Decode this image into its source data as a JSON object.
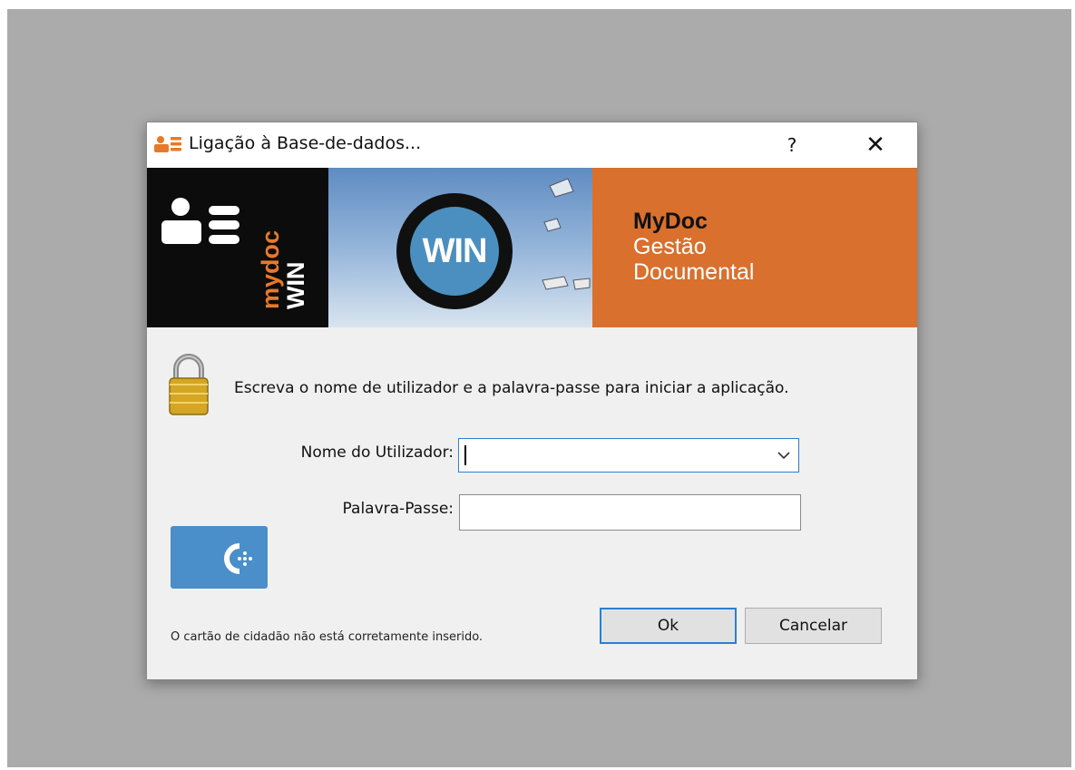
{
  "window": {
    "title": "Ligação à Base-de-dados...",
    "help_label": "?",
    "close_label": "✕"
  },
  "banner": {
    "brand_my": "my",
    "brand_doc": "doc",
    "brand_win": "WIN",
    "circle_text": "WIN",
    "product_name": "MyDoc",
    "product_line1": "Gestão",
    "product_line2": "Documental",
    "colors": {
      "left": "#0c0c0c",
      "right": "#d9702e",
      "circle": "#4a8fc0"
    }
  },
  "login": {
    "instruction": "Escreva o nome de utilizador e a palavra-passe para iniciar a aplicação.",
    "user_label": "Nome do Utilizador:",
    "user_value": "",
    "pass_label": "Palavra-Passe:",
    "pass_value": ""
  },
  "card": {
    "icon": "citizen-card-icon",
    "status": "O cartão de cidadão não está corretamente inserido."
  },
  "buttons": {
    "ok_label": "Ok",
    "cancel_label": "Cancelar"
  }
}
